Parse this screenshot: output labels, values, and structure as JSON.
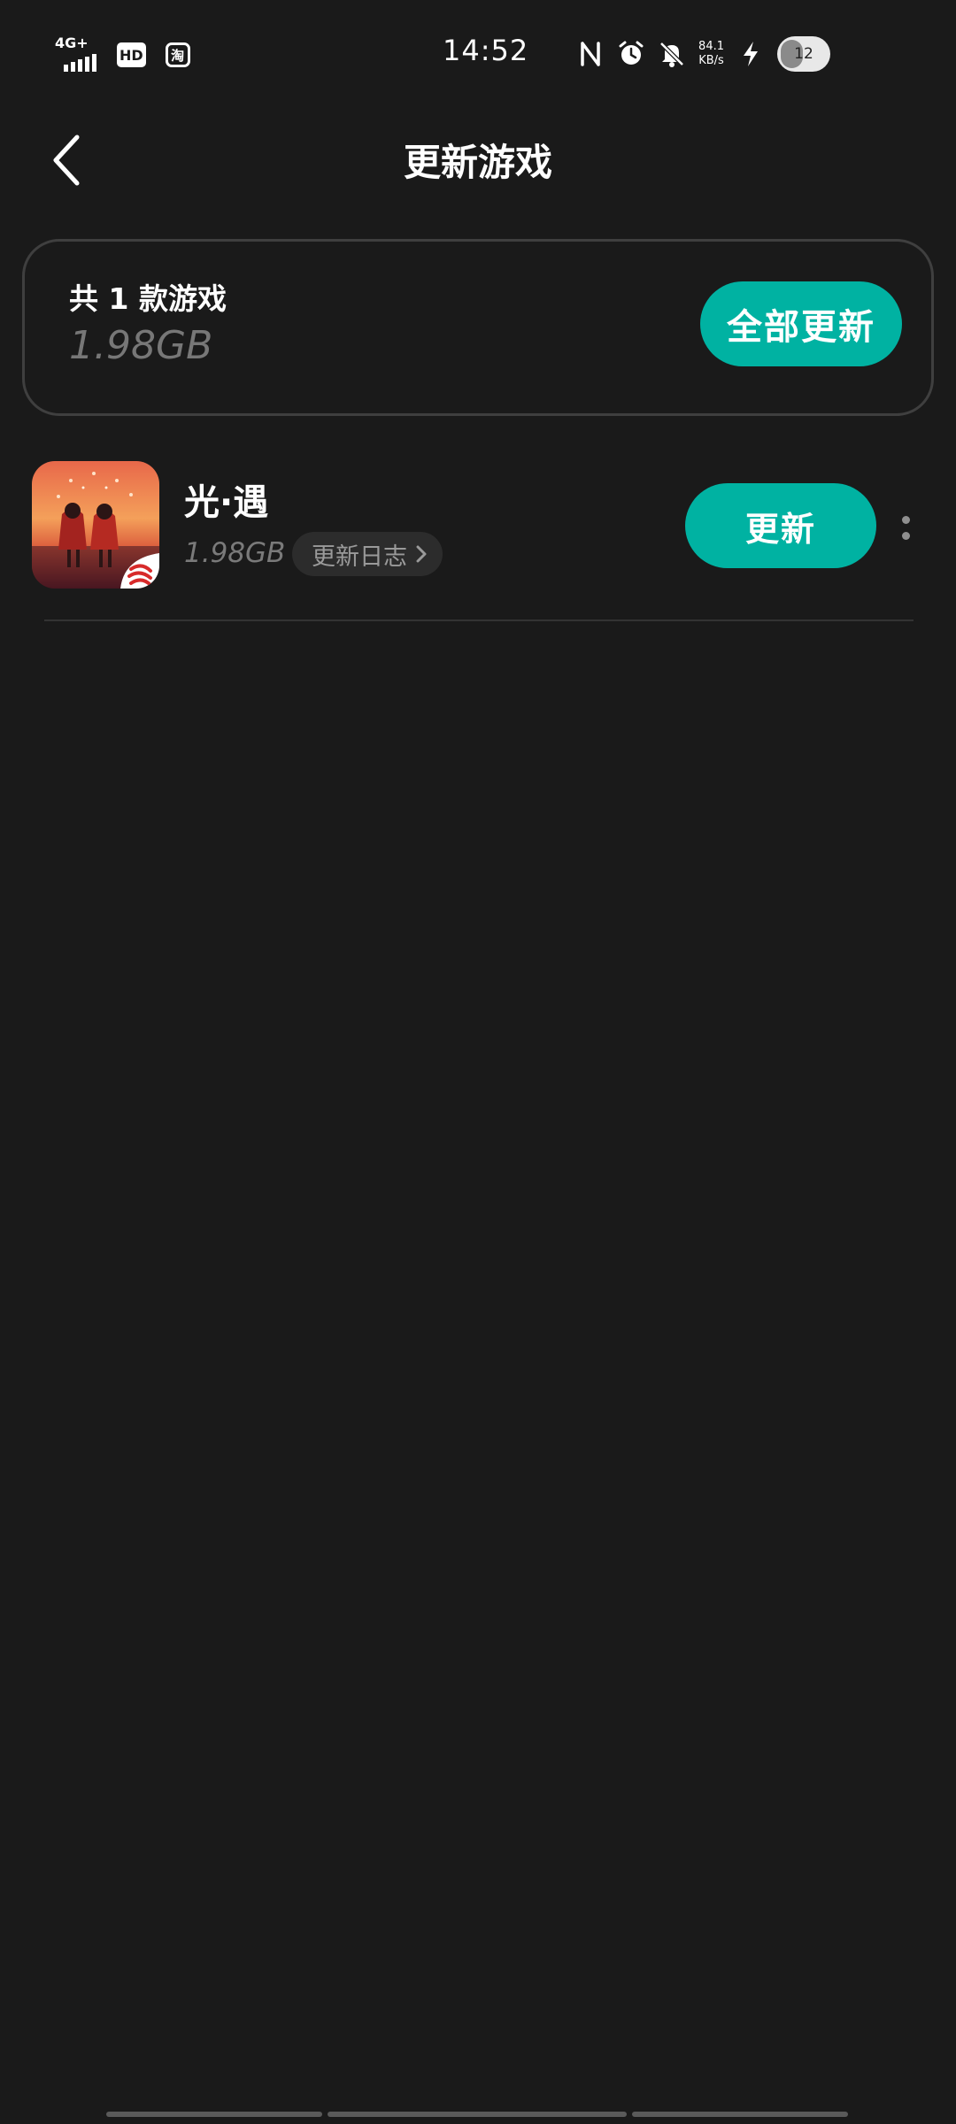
{
  "status_bar": {
    "network": "4G+",
    "hd_badge": "HD",
    "taobao_badge": "淘",
    "time": "14:52",
    "net_speed_value": "84.1",
    "net_speed_unit": "KB/s",
    "battery_level": "12",
    "battery_fraction": 0.12,
    "icons": [
      "signal-icon",
      "hd-icon",
      "taobao-icon",
      "nfc-icon",
      "alarm-icon",
      "mute-icon",
      "charging-icon",
      "battery-icon"
    ]
  },
  "header": {
    "title": "更新游戏",
    "back_icon": "chevron-left-icon"
  },
  "summary": {
    "count_text": "共 1 款游戏",
    "total_size": "1.98GB",
    "update_all_label": "全部更新"
  },
  "games": [
    {
      "name": "光·遇",
      "size": "1.98GB",
      "changelog_label": "更新日志",
      "update_label": "更新"
    }
  ],
  "colors": {
    "background": "#1a1a1a",
    "accent": "#00b2a2",
    "card_border": "#3f3f3f",
    "muted_text": "#777777"
  }
}
